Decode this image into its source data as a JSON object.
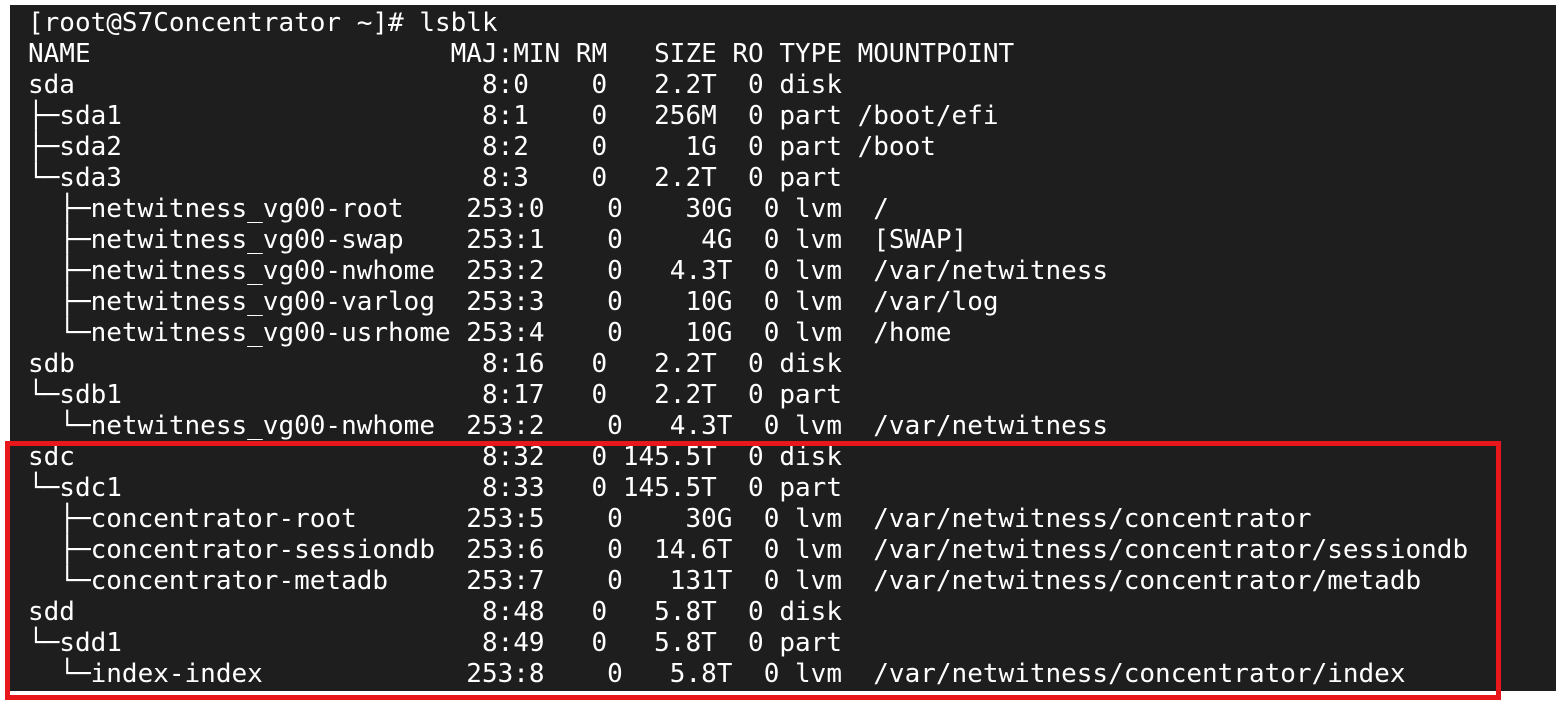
{
  "terminal": {
    "prompt_line": "[root@S7Concentrator ~]# lsblk",
    "header": "NAME                       MAJ:MIN RM   SIZE RO TYPE MOUNTPOINT",
    "rows": [
      "sda                          8:0    0   2.2T  0 disk",
      "├─sda1                       8:1    0   256M  0 part /boot/efi",
      "├─sda2                       8:2    0     1G  0 part /boot",
      "└─sda3                       8:3    0   2.2T  0 part",
      "  ├─netwitness_vg00-root    253:0    0    30G  0 lvm  /",
      "  ├─netwitness_vg00-swap    253:1    0     4G  0 lvm  [SWAP]",
      "  ├─netwitness_vg00-nwhome  253:2    0   4.3T  0 lvm  /var/netwitness",
      "  ├─netwitness_vg00-varlog  253:3    0    10G  0 lvm  /var/log",
      "  └─netwitness_vg00-usrhome 253:4    0    10G  0 lvm  /home",
      "sdb                          8:16   0   2.2T  0 disk",
      "└─sdb1                       8:17   0   2.2T  0 part",
      "  └─netwitness_vg00-nwhome  253:2    0   4.3T  0 lvm  /var/netwitness",
      "sdc                          8:32   0 145.5T  0 disk",
      "└─sdc1                       8:33   0 145.5T  0 part",
      "  ├─concentrator-root       253:5    0    30G  0 lvm  /var/netwitness/concentrator",
      "  ├─concentrator-sessiondb  253:6    0  14.6T  0 lvm  /var/netwitness/concentrator/sessiondb",
      "  └─concentrator-metadb     253:7    0   131T  0 lvm  /var/netwitness/concentrator/metadb",
      "sdd                          8:48   0   5.8T  0 disk",
      "└─sdd1                       8:49   0   5.8T  0 part",
      "  └─index-index             253:8    0   5.8T  0 lvm  /var/netwitness/concentrator/index"
    ]
  },
  "colors": {
    "background": "#1e1e1e",
    "text": "#ffffff",
    "highlight": "#e8171b"
  }
}
